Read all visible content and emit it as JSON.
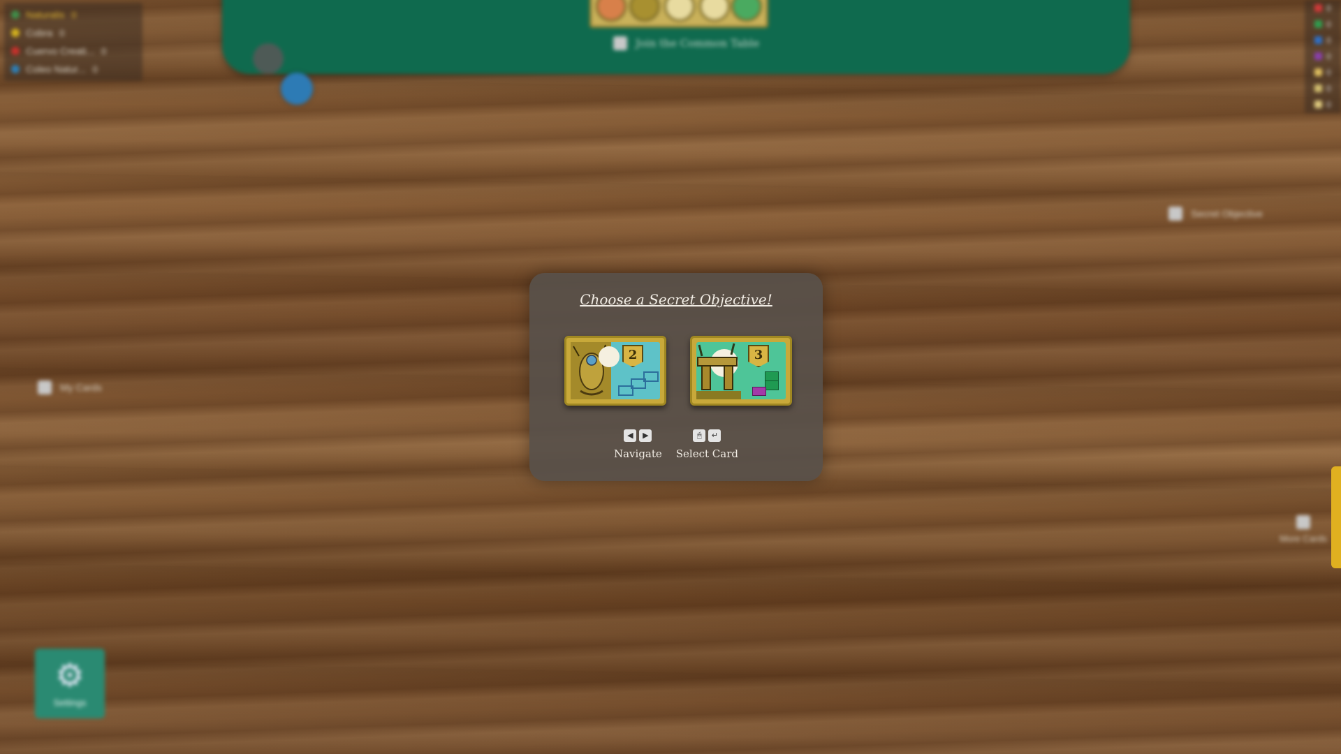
{
  "players": [
    {
      "name": "Naturalis",
      "count": "0",
      "color": "#3f8f4a",
      "highlight": "#e0b632"
    },
    {
      "name": "Cobra",
      "count": "0",
      "color": "#d4b21e",
      "highlight": "#d9d2c5"
    },
    {
      "name": "Cuervo Creati...",
      "count": "0",
      "color": "#c8312c",
      "highlight": "#d9d2c5"
    },
    {
      "name": "Coleo Natur...",
      "count": "0",
      "color": "#2c7fb8",
      "highlight": "#d9d2c5"
    }
  ],
  "common_table": {
    "join_label": "Join the Common Table"
  },
  "resources": [
    {
      "icon": "red-gem-icon",
      "color": "#d23a3a",
      "value": "0"
    },
    {
      "icon": "green-gem-icon",
      "color": "#2fa050",
      "value": "0"
    },
    {
      "icon": "blue-gem-icon",
      "color": "#2e70c8",
      "value": "0"
    },
    {
      "icon": "purple-gem-icon",
      "color": "#8a3fb0",
      "value": "0"
    },
    {
      "icon": "feather-icon",
      "color": "#e0c060",
      "value": "0"
    },
    {
      "icon": "quill-icon",
      "color": "#d4c070",
      "value": "0"
    },
    {
      "icon": "scroll-icon",
      "color": "#e0cc80",
      "value": "0"
    }
  ],
  "side_labels": {
    "secret_objective": "Secret Objective",
    "my_cards": "My Cards",
    "more_cards": "More Cards"
  },
  "settings": {
    "label": "Settings",
    "icon": "gear-icon"
  },
  "modal": {
    "title": "Choose a Secret Objective!",
    "cards": [
      {
        "points": "2",
        "art": "owl-icon",
        "color": "#5ec2c8"
      },
      {
        "points": "3",
        "art": "dolmen-icon",
        "color": "#4ec598"
      }
    ],
    "controls": [
      {
        "label": "Navigate",
        "keys": [
          "◀",
          "▶"
        ]
      },
      {
        "label": "Select Card",
        "keys": [
          "🖱",
          "↵"
        ]
      }
    ]
  }
}
